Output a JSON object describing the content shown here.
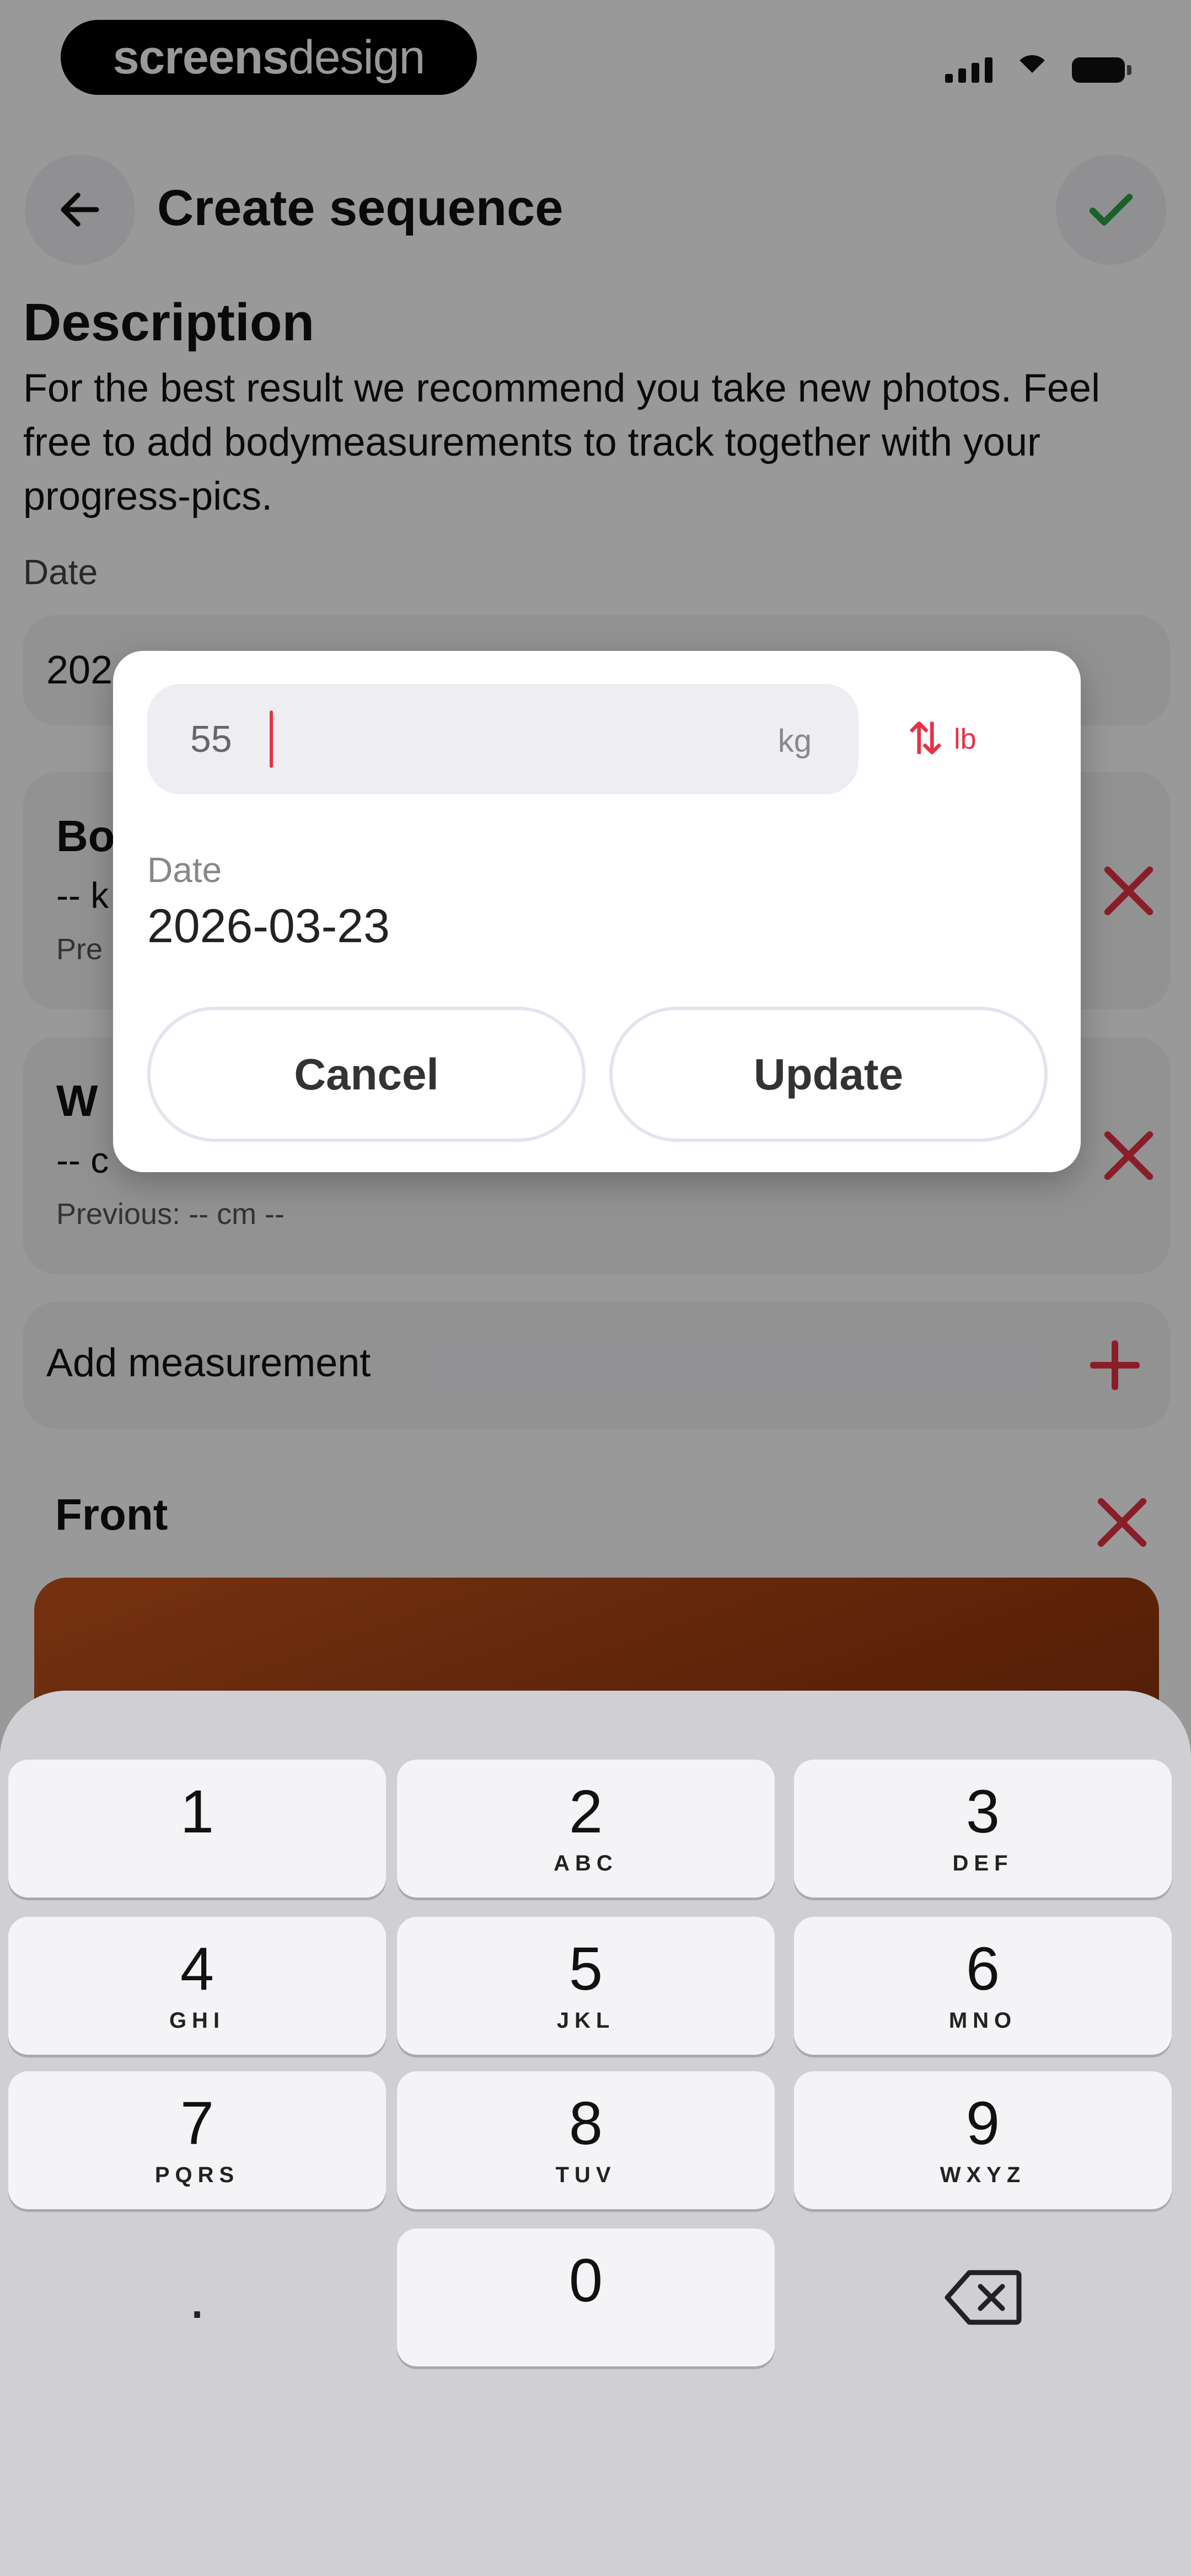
{
  "status_bar": {
    "brand_bold": "screens",
    "brand_light": "design"
  },
  "header": {
    "title": "Create sequence"
  },
  "description": {
    "heading": "Description",
    "text": "For the best result we recommend you take new photos. Feel free to add bodymeasurements to track together with your progress-pics."
  },
  "date_field": {
    "label": "Date",
    "value": "202"
  },
  "measurements": [
    {
      "title": "Bo",
      "value": "-- k",
      "previous": "Pre"
    },
    {
      "title": "W",
      "value": "-- c",
      "previous": "Previous: -- cm --"
    }
  ],
  "add_measurement": {
    "label": "Add measurement"
  },
  "photo_section": {
    "label": "Front"
  },
  "dialog": {
    "weight_value": "55",
    "unit": "kg",
    "alt_unit": "lb",
    "swap_icon": "swap-arrows-icon",
    "date_label": "Date",
    "date_value": "2026-03-23",
    "cancel_label": "Cancel",
    "update_label": "Update"
  },
  "keypad": {
    "keys": [
      {
        "digit": "1",
        "letters": ""
      },
      {
        "digit": "2",
        "letters": "ABC"
      },
      {
        "digit": "3",
        "letters": "DEF"
      },
      {
        "digit": "4",
        "letters": "GHI"
      },
      {
        "digit": "5",
        "letters": "JKL"
      },
      {
        "digit": "6",
        "letters": "MNO"
      },
      {
        "digit": "7",
        "letters": "PQRS"
      },
      {
        "digit": "8",
        "letters": "TUV"
      },
      {
        "digit": "9",
        "letters": "WXYZ"
      },
      {
        "digit": "0",
        "letters": ""
      }
    ],
    "decimal": ".",
    "backspace_icon": "backspace-icon"
  },
  "colors": {
    "accent": "#e53245",
    "success": "#2ca24a",
    "surface": "#f3f3f6"
  }
}
